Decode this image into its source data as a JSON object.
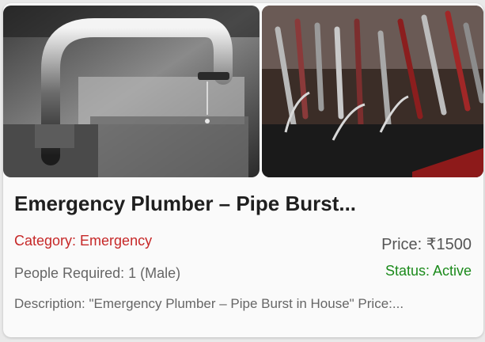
{
  "listing": {
    "title": "Emergency Plumber – Pipe Burst...",
    "category": "Category: Emergency",
    "price": "Price: ₹1500",
    "people_required": "People Required: 1 (Male)",
    "status": "Status: Active",
    "description": "Description: \"Emergency Plumber – Pipe Burst in House\" Price:..."
  },
  "images": {
    "left": "faucet-photo",
    "right": "tools-photo"
  },
  "colors": {
    "category": "#c62828",
    "status": "#1b8a1b"
  }
}
